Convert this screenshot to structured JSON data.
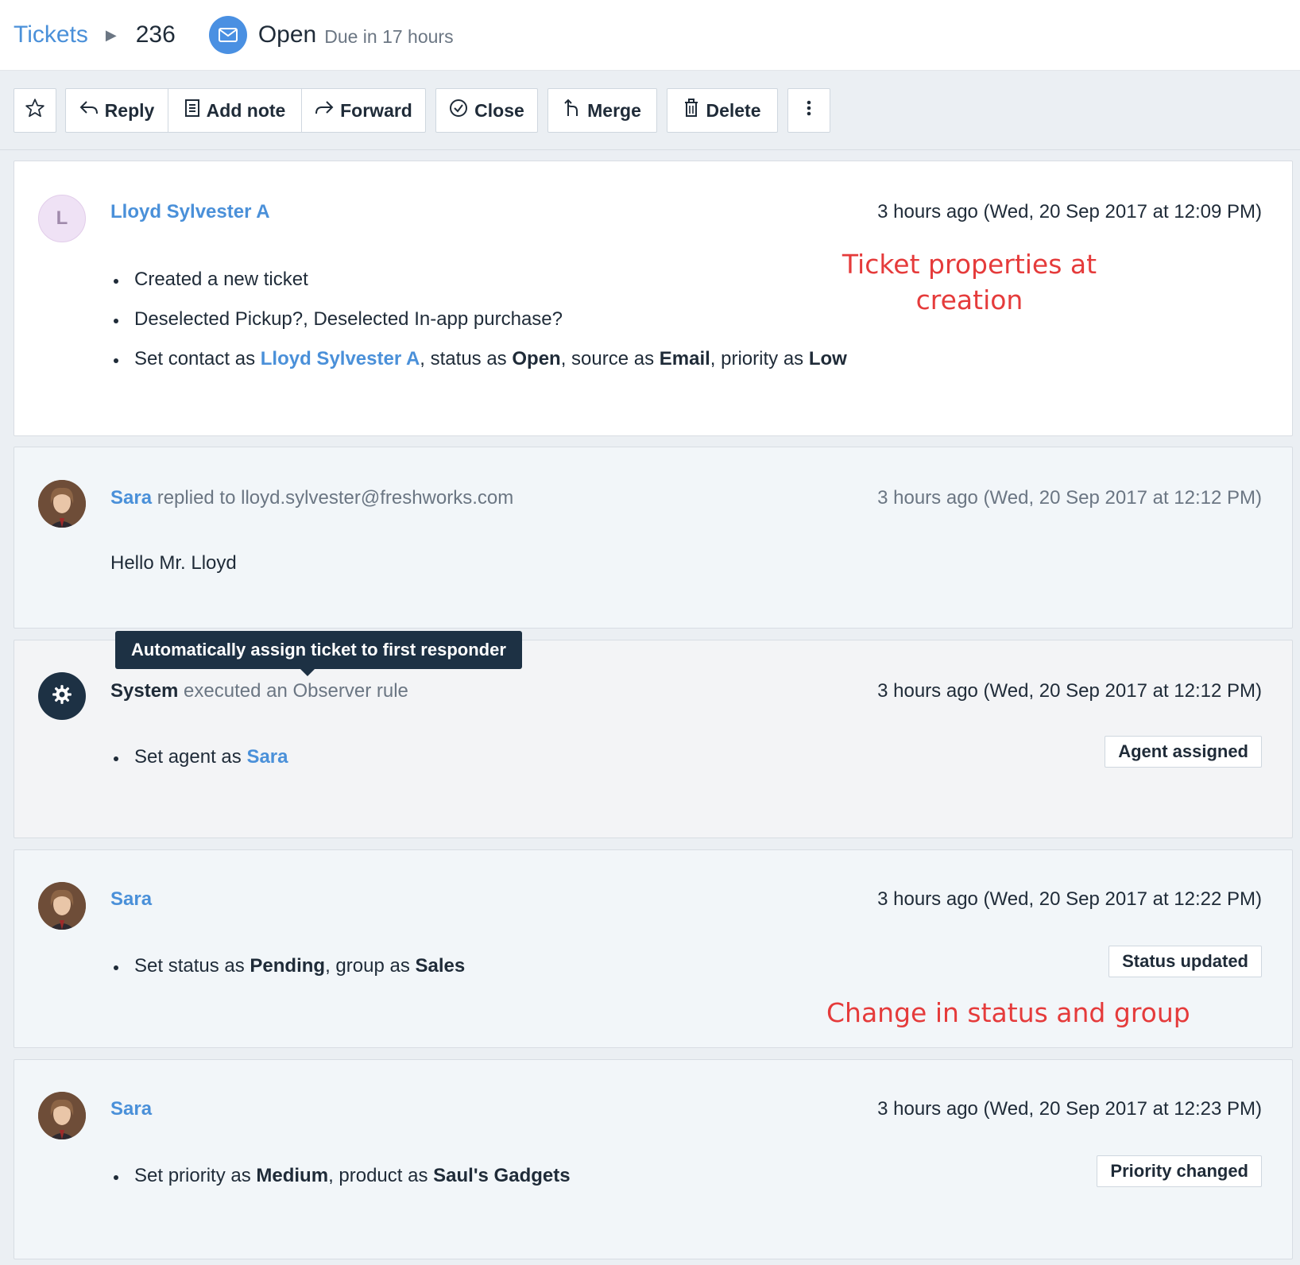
{
  "header": {
    "breadcrumb_link": "Tickets",
    "ticket_id": "236",
    "status": "Open",
    "due": "Due in 17 hours"
  },
  "toolbar": {
    "reply": "Reply",
    "add_note": "Add note",
    "forward": "Forward",
    "close": "Close",
    "merge": "Merge",
    "delete": "Delete"
  },
  "activities": [
    {
      "avatar_letter": "L",
      "author": "Lloyd Sylvester A",
      "time": "3 hours ago (Wed, 20 Sep 2017 at 12:09 PM)",
      "items": {
        "created": "Created a new ticket",
        "deselected": "Deselected Pickup?, Deselected In-app purchase?",
        "set_contact_prefix": "Set contact as ",
        "contact": "Lloyd Sylvester A",
        "status_prefix": ", status as ",
        "status": "Open",
        "source_prefix": ", source as ",
        "source": "Email",
        "priority_prefix": ", priority as ",
        "priority": "Low"
      }
    },
    {
      "author": "Sara",
      "action": " replied to ",
      "recipient": "lloyd.sylvester@freshworks.com",
      "time": "3 hours ago (Wed, 20 Sep 2017 at 12:12 PM)",
      "body": "Hello Mr. Lloyd"
    },
    {
      "author": "System",
      "action": " executed an Observer rule",
      "time": "3 hours ago (Wed, 20 Sep 2017 at 12:12 PM)",
      "tooltip": "Automatically assign ticket to first responder",
      "item_prefix": "Set agent as ",
      "agent": "Sara",
      "tag": "Agent assigned"
    },
    {
      "author": "Sara",
      "time": "3 hours ago (Wed, 20 Sep 2017 at 12:22 PM)",
      "status_prefix": "Set status as ",
      "status": "Pending",
      "group_prefix": ", group as ",
      "group": "Sales",
      "tag": "Status updated"
    },
    {
      "author": "Sara",
      "time": "3 hours ago (Wed, 20 Sep 2017 at 12:23 PM)",
      "priority_prefix": "Set priority as ",
      "priority": "Medium",
      "product_prefix": ", product as ",
      "product": "Saul's Gadgets",
      "tag": "Priority changed"
    }
  ],
  "annotations": {
    "creation_line1": "Ticket properties at",
    "creation_line2": "creation",
    "change": "Change in status and group"
  },
  "colors": {
    "link": "#4a90d9",
    "annotation": "#e53b3b",
    "system_avatar": "#1d3144",
    "status_icon": "#4a90e2"
  }
}
